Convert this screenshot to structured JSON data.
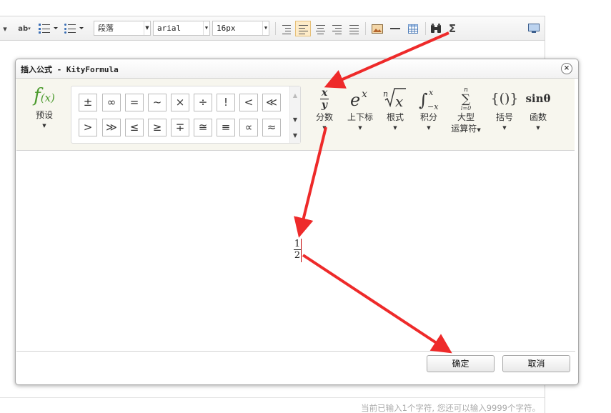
{
  "editor": {
    "toolbar": {
      "paragraph_select": "段落",
      "font_select": "arial",
      "size_select": "16px"
    },
    "status_text": "当前已输入1个字符, 您还可以输入9999个字符。"
  },
  "dialog": {
    "title": "插入公式 - KityFormula",
    "close_glyph": "×",
    "preset": {
      "label": "预设"
    },
    "symbols_row1": [
      "±",
      "∞",
      "=",
      "~",
      "×",
      "÷",
      "!",
      "<",
      "≪"
    ],
    "symbols_row2": [
      ">",
      "≫",
      "≤",
      "≥",
      "∓",
      "≅",
      "≡",
      "∝",
      "≈"
    ],
    "groups": [
      {
        "label": "分数"
      },
      {
        "label": "上下标"
      },
      {
        "label": "根式"
      },
      {
        "label": "积分"
      },
      {
        "label": "大型",
        "label2": "运算符"
      },
      {
        "label": "括号"
      },
      {
        "label": "函数"
      }
    ],
    "formula": {
      "numerator": "1",
      "denominator": "2"
    },
    "ok_label": "确定",
    "cancel_label": "取消"
  },
  "colors": {
    "arrow": "#ee2a2a",
    "accent_green": "#4a9a2c",
    "active_align": "#fdebc8"
  }
}
